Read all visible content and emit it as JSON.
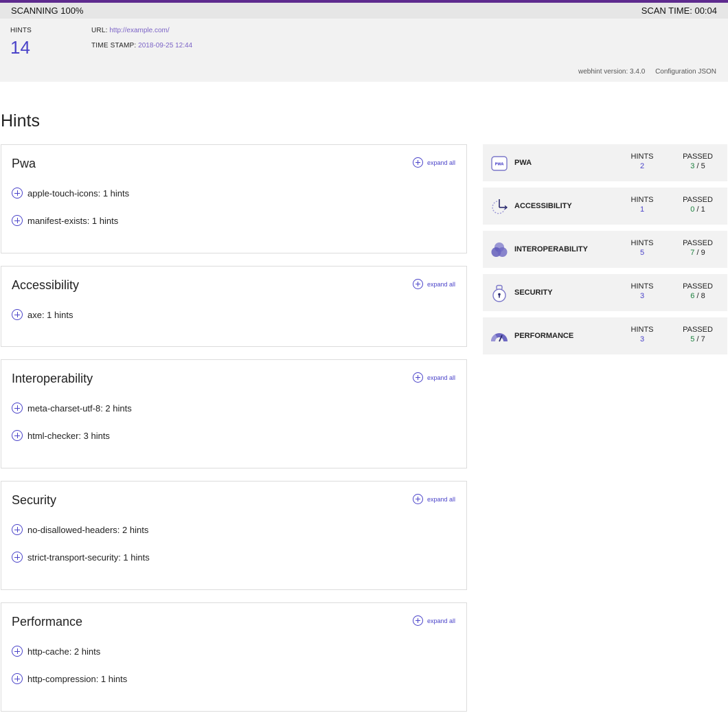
{
  "scan": {
    "status": "SCANNING 100%",
    "time": "SCAN TIME: 00:04"
  },
  "header": {
    "hints_label": "HINTS",
    "hints_count": "14",
    "url_label": "URL:",
    "url_value": "http://example.com/",
    "timestamp_label": "TIME STAMP:",
    "timestamp_value": "2018-09-25 12:44",
    "version": "webhint version: 3.4.0",
    "config_link": "Configuration JSON"
  },
  "page_title": "Hints",
  "expand_all_label": "expand all",
  "categories": [
    {
      "name": "Pwa",
      "hints": [
        "apple-touch-icons: 1 hints",
        "manifest-exists: 1 hints"
      ]
    },
    {
      "name": "Accessibility",
      "hints": [
        "axe: 1 hints"
      ]
    },
    {
      "name": "Interoperability",
      "hints": [
        "meta-charset-utf-8: 2 hints",
        "html-checker: 3 hints"
      ]
    },
    {
      "name": "Security",
      "hints": [
        "no-disallowed-headers: 2 hints",
        "strict-transport-security: 1 hints"
      ]
    },
    {
      "name": "Performance",
      "hints": [
        "http-cache: 2 hints",
        "http-compression: 1 hints"
      ]
    }
  ],
  "summary": {
    "hints_label": "HINTS",
    "passed_label": "PASSED",
    "rows": [
      {
        "name": "PWA",
        "icon": "pwa-icon",
        "hints": "2",
        "passed": "3",
        "total": "5"
      },
      {
        "name": "ACCESSIBILITY",
        "icon": "accessibility-icon",
        "hints": "1",
        "passed": "0",
        "total": "1"
      },
      {
        "name": "INTEROPERABILITY",
        "icon": "interoperability-icon",
        "hints": "5",
        "passed": "7",
        "total": "9"
      },
      {
        "name": "SECURITY",
        "icon": "security-icon",
        "hints": "3",
        "passed": "6",
        "total": "8"
      },
      {
        "name": "PERFORMANCE",
        "icon": "performance-icon",
        "hints": "3",
        "passed": "5",
        "total": "7"
      }
    ]
  },
  "colors": {
    "accent": "#4a43c9",
    "passed": "#1a7f3c",
    "progress": "#5e2a8e"
  }
}
